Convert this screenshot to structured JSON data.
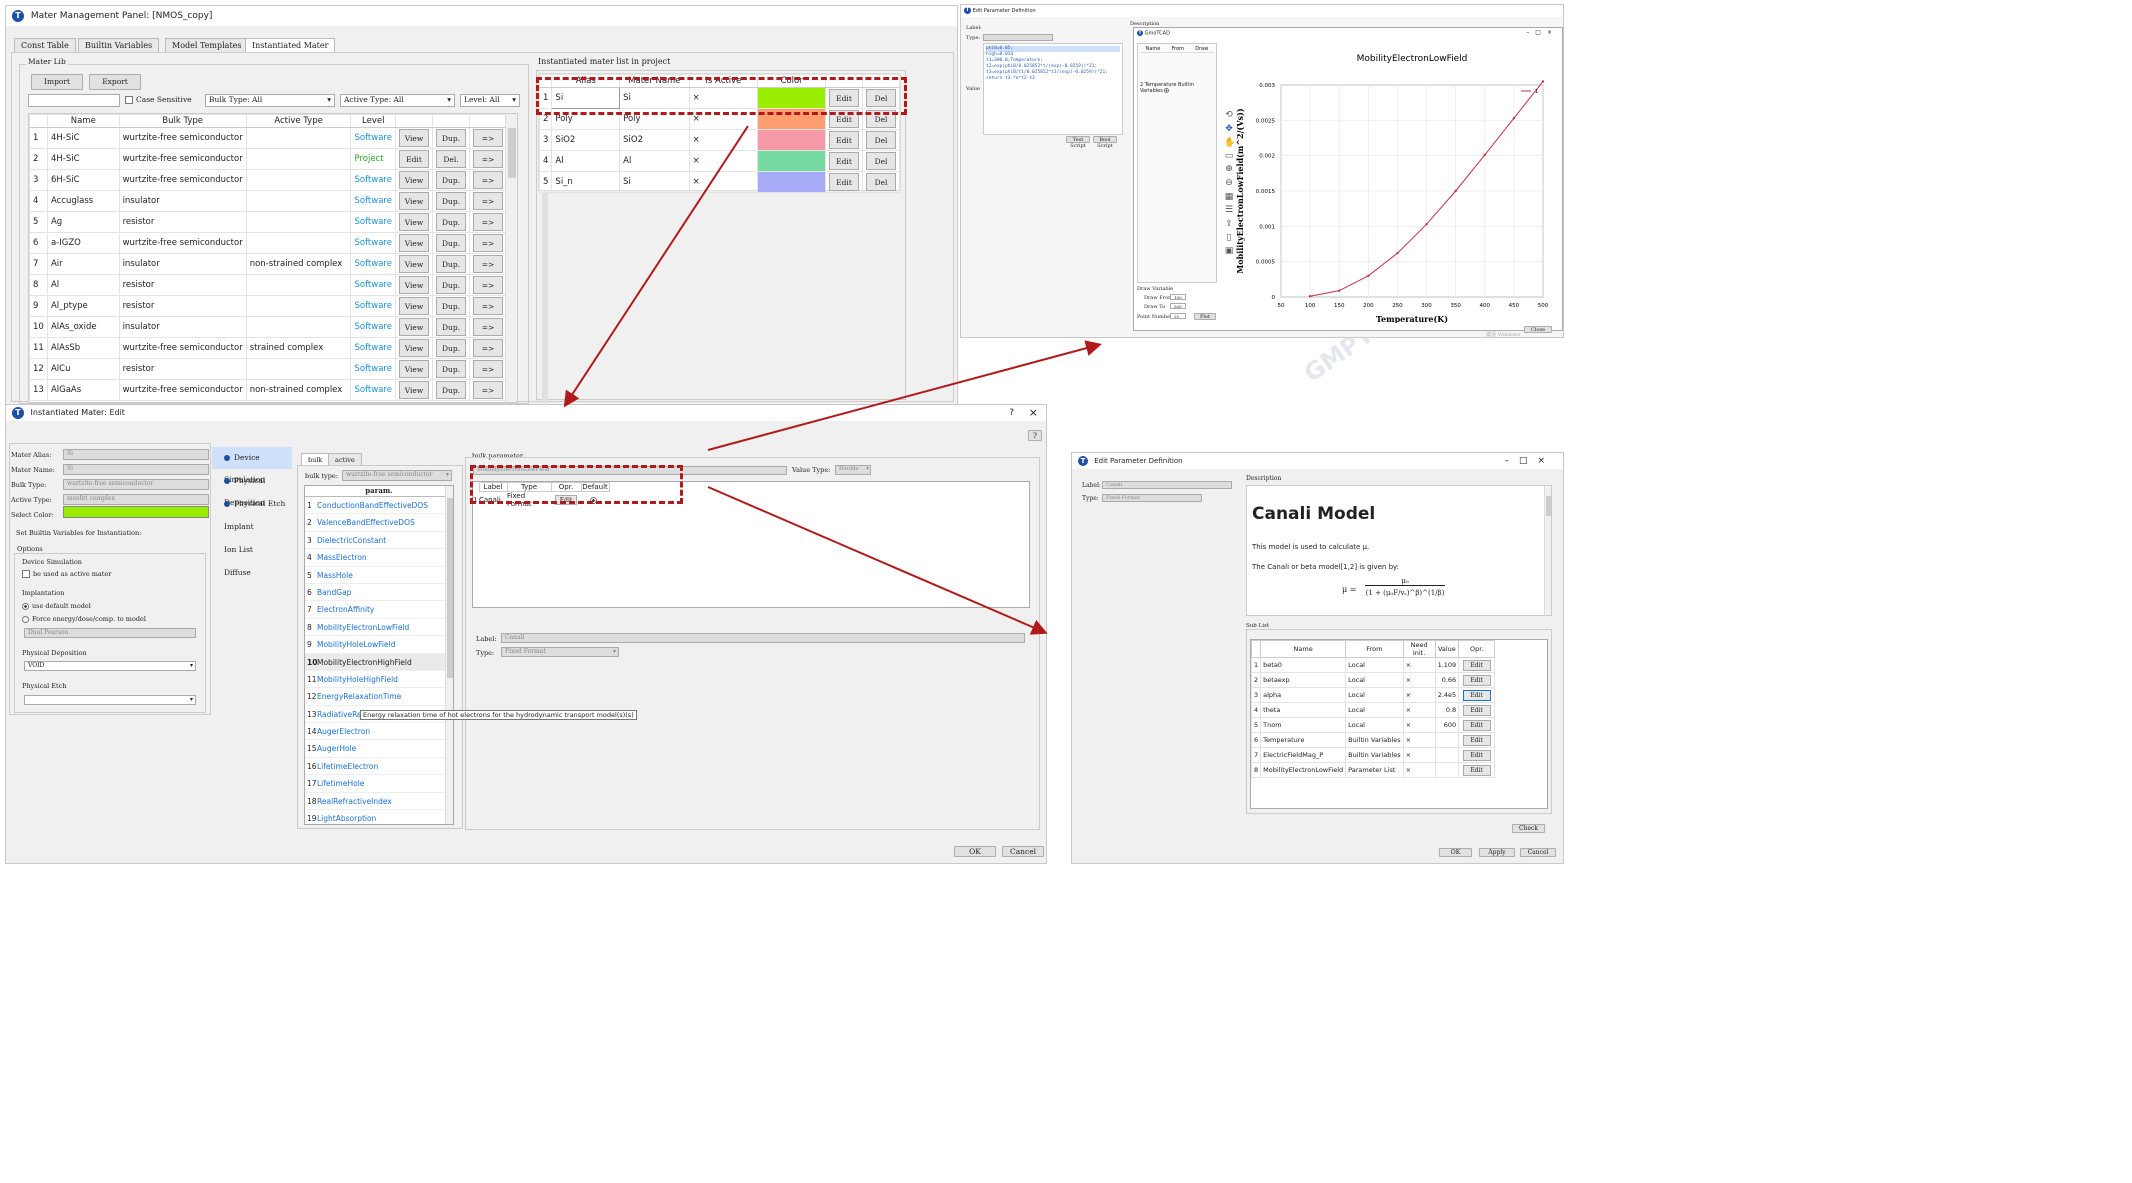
{
  "main": {
    "title": "Mater Management Panel: [NMOS_copy]",
    "tabs": [
      "Const Table",
      "Builtin Variables",
      "Model Templates",
      "Instantiated Mater"
    ],
    "lib_title": "Mater Lib",
    "import": "Import",
    "export": "Export",
    "case_sensitive": "Case Sensitive",
    "bulk_type_filter": "Bulk Type: All",
    "active_type_filter": "Active Type: All",
    "level_filter": "Level: All",
    "columns": [
      "Name",
      "Bulk Type",
      "Active Type",
      "Level"
    ],
    "rows": [
      {
        "n": "1",
        "name": "4H-SiC",
        "bulk": "wurtzite-free semiconductor",
        "active": "",
        "level": "Software",
        "b1": "View",
        "b2": "Dup."
      },
      {
        "n": "2",
        "name": "4H-SiC",
        "bulk": "wurtzite-free semiconductor",
        "active": "",
        "level": "Project",
        "b1": "Edit",
        "b2": "Del."
      },
      {
        "n": "3",
        "name": "6H-SiC",
        "bulk": "wurtzite-free semiconductor",
        "active": "",
        "level": "Software",
        "b1": "View",
        "b2": "Dup."
      },
      {
        "n": "4",
        "name": "Accuglass",
        "bulk": "insulator",
        "active": "",
        "level": "Software",
        "b1": "View",
        "b2": "Dup."
      },
      {
        "n": "5",
        "name": "Ag",
        "bulk": "resistor",
        "active": "",
        "level": "Software",
        "b1": "View",
        "b2": "Dup."
      },
      {
        "n": "6",
        "name": "a-IGZO",
        "bulk": "wurtzite-free semiconductor",
        "active": "",
        "level": "Software",
        "b1": "View",
        "b2": "Dup."
      },
      {
        "n": "7",
        "name": "Air",
        "bulk": "insulator",
        "active": "non-strained complex",
        "level": "Software",
        "b1": "View",
        "b2": "Dup."
      },
      {
        "n": "8",
        "name": "Al",
        "bulk": "resistor",
        "active": "",
        "level": "Software",
        "b1": "View",
        "b2": "Dup."
      },
      {
        "n": "9",
        "name": "Al_ptype",
        "bulk": "resistor",
        "active": "",
        "level": "Software",
        "b1": "View",
        "b2": "Dup."
      },
      {
        "n": "10",
        "name": "AlAs_oxide",
        "bulk": "insulator",
        "active": "",
        "level": "Software",
        "b1": "View",
        "b2": "Dup."
      },
      {
        "n": "11",
        "name": "AlAsSb",
        "bulk": "wurtzite-free semiconductor",
        "active": "strained complex",
        "level": "Software",
        "b1": "View",
        "b2": "Dup."
      },
      {
        "n": "12",
        "name": "AlCu",
        "bulk": "resistor",
        "active": "",
        "level": "Software",
        "b1": "View",
        "b2": "Dup."
      },
      {
        "n": "13",
        "name": "AlGaAs",
        "bulk": "wurtzite-free semiconductor",
        "active": "non-strained complex",
        "level": "Software",
        "b1": "View",
        "b2": "Dup."
      }
    ],
    "arrow": "=>",
    "inst_title": "Instantiated mater list in project",
    "inst_columns": [
      "Alias",
      "Mater Name",
      "Is Active",
      "Color"
    ],
    "inst_rows": [
      {
        "n": "1",
        "alias": "Si",
        "mater": "Si",
        "active": "×",
        "color": "#99ee00"
      },
      {
        "n": "2",
        "alias": "Poly",
        "mater": "Poly",
        "active": "×",
        "color": "#ff9e6e"
      },
      {
        "n": "3",
        "alias": "SiO2",
        "mater": "SiO2",
        "active": "×",
        "color": "#f79aa8"
      },
      {
        "n": "4",
        "alias": "Al",
        "mater": "Al",
        "active": "×",
        "color": "#76dba0"
      },
      {
        "n": "5",
        "alias": "Si_n",
        "mater": "Si",
        "active": "×",
        "color": "#a7aaf7"
      }
    ],
    "edit": "Edit",
    "del": "Del"
  },
  "plotwin": {
    "title": "Edit Parameter Definition",
    "inner_title": "GmoTCAD",
    "label": "Label:",
    "type": "Type:",
    "description": "Description",
    "value": "Value",
    "code": [
      "phiB=0.05;",
      "high=0.014",
      "t1=300.0;Temperature;",
      "t2=exp(phiB/0.025852*t/(exp(-0.0259))*21;",
      "t3=exp(phiB/t1/0.025852*t1/(exp(-0.0259))*21;",
      "return t3.*e*t2-t3"
    ],
    "cols": [
      "Name",
      "From",
      "Draw"
    ],
    "var_row": "Temperature Builtin Variables",
    "test_script": "Test Script",
    "bool_script": "Bool Script",
    "draw_var": "Draw Variable",
    "draw_from": "Draw From",
    "draw_to": "Draw To",
    "point_number": "Point Number",
    "draw_from_v": "100",
    "draw_to_v": "500",
    "point_number_v": "25",
    "plot_btn": "Plot",
    "close": "Close",
    "windows_mark": "激活 Windows"
  },
  "chart_data": {
    "type": "line",
    "title": "MobilityElectronLowField",
    "xlabel": "Temperature(K)",
    "ylabel": "MobilityElectronLowField(m^2/(Vs))",
    "x": [
      100,
      150,
      200,
      250,
      300,
      350,
      400,
      450,
      500
    ],
    "y": [
      1e-05,
      9e-05,
      0.0003,
      0.00062,
      0.00103,
      0.0015,
      0.00201,
      0.00253,
      0.00305
    ],
    "xlim": [
      50,
      500
    ],
    "ylim": [
      0,
      0.003
    ],
    "xticks": [
      "50",
      "100",
      "150",
      "200",
      "250",
      "300",
      "350",
      "400",
      "450",
      "500"
    ],
    "yticks": [
      "0",
      "0.0005",
      "0.001",
      "0.0015",
      "0.002",
      "0.0025",
      "0.003"
    ],
    "series": [
      {
        "name": "1",
        "color": "#c0304a"
      }
    ],
    "grid": true,
    "legend": "top-right"
  },
  "editwin": {
    "title": "Instantiated Mater: Edit",
    "help": "?",
    "fields": [
      {
        "label": "Mater Alias:",
        "value": "Si"
      },
      {
        "label": "Mater Name:",
        "value": "Si"
      },
      {
        "label": "Bulk Type:",
        "value": "wurtzite-free semiconductor"
      },
      {
        "label": "Active Type:",
        "value": "mosfet complex"
      },
      {
        "label": "Select Color:",
        "value": ""
      }
    ],
    "select_color": "#99ee00",
    "set_builtin": "Set Builtin Variables for Instantiation:",
    "options": "Options",
    "device_sim": "Device Simulation",
    "be_active": "be used as active mater",
    "implantation": "Implantation",
    "use_default": "use default model",
    "force": "Force energy/dose/comp. to model",
    "dual_pearson": "Dual Pearson",
    "phys_dep": "Physical Deposition",
    "phys_dep_val": "VOID",
    "phys_etch": "Physical Etch",
    "phys_etch_val": "",
    "side_items": [
      "Device Simulation",
      "Physical Deposition",
      "Physical Etch",
      "Implant",
      "Ion List",
      "Diffuse"
    ],
    "tabs": [
      "bulk",
      "active"
    ],
    "bulk_type_lbl": "bulk type:",
    "bulk_type_val": "wurtzite-free semiconductor",
    "param_header": "param.",
    "params": [
      "ConductionBandEffectiveDOS",
      "ValenceBandEffectiveDOS",
      "DielectricConstant",
      "MassElectron",
      "MassHole",
      "BandGap",
      "ElectronAffinity",
      "MobilityElectronLowField",
      "MobilityHoleLowField",
      "MobilityElectronHighField",
      "MobilityHoleHighField",
      "EnergyRelaxationTime",
      "RadiativeRe",
      "AugerElectron",
      "AugerHole",
      "LifetimeElectron",
      "LifetimeHole",
      "RealRefractiveIndex",
      "LightAbsorption"
    ],
    "tooltip": "Energy relaxation time of hot electrons for the hydrodynamic transport model(s)(s)",
    "bulk_parameter": "bulk parameter",
    "param_name": "MobilityElectronLowField",
    "value_type_lbl": "Value Type:",
    "value_type": "Double",
    "sub_cols": [
      "Label",
      "Type",
      "Opr.",
      "Default"
    ],
    "sub_row": {
      "n": "1",
      "label": "Canali",
      "type": "Fixed Format",
      "opr": "Edit"
    },
    "label_lbl": "Label:",
    "label_val": "Canali",
    "type_lbl": "Type:",
    "type_val": "Fixed Format",
    "ok": "OK",
    "cancel": "Cancel"
  },
  "canali": {
    "title": "Edit Parameter Definition",
    "label_lbl": "Label:",
    "label_val": "Canali",
    "type_lbl": "Type:",
    "type_val": "Fixed Format",
    "description": "Description",
    "heading": "Canali Model",
    "text1": "This model is used to calculate μ.",
    "text2": "The Canali or beta model[1,2] is given by:",
    "formula_lhs": "μ =",
    "formula_num": "μ₀",
    "formula_den": "(1 + (μ₀F/vₛ)^β)^(1/β)",
    "sublist": "Sub List",
    "cols": [
      "Name",
      "From",
      "Need Init.",
      "Value",
      "Opr."
    ],
    "rows": [
      {
        "n": "1",
        "name": "beta0",
        "from": "Local",
        "init": "×",
        "value": "1.109",
        "opr": "Edit"
      },
      {
        "n": "2",
        "name": "betaexp",
        "from": "Local",
        "init": "×",
        "value": "0.66",
        "opr": "Edit"
      },
      {
        "n": "3",
        "name": "alpha",
        "from": "Local",
        "init": "×",
        "value": "2.4e5",
        "opr": "Edit"
      },
      {
        "n": "4",
        "name": "theta",
        "from": "Local",
        "init": "×",
        "value": "0.8",
        "opr": "Edit"
      },
      {
        "n": "5",
        "name": "Tnom",
        "from": "Local",
        "init": "×",
        "value": "600",
        "opr": "Edit"
      },
      {
        "n": "6",
        "name": "Temperature",
        "from": "Builtin Variables",
        "init": "×",
        "value": "",
        "opr": "Edit"
      },
      {
        "n": "7",
        "name": "ElectricFieldMag_P",
        "from": "Builtin Variables",
        "init": "×",
        "value": "",
        "opr": "Edit"
      },
      {
        "n": "8",
        "name": "MobilityElectronLowField",
        "from": "Parameter List",
        "init": "×",
        "value": "",
        "opr": "Edit"
      }
    ],
    "check": "Check",
    "ok": "OK",
    "apply": "Apply",
    "cancel": "Cancel"
  }
}
